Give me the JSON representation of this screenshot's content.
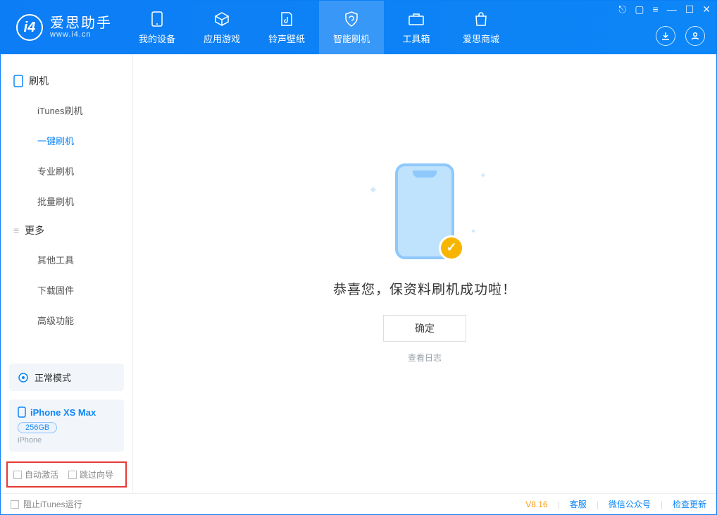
{
  "app": {
    "name": "爱思助手",
    "domain": "www.i4.cn"
  },
  "tabs": [
    {
      "label": "我的设备"
    },
    {
      "label": "应用游戏"
    },
    {
      "label": "铃声壁纸"
    },
    {
      "label": "智能刷机"
    },
    {
      "label": "工具箱"
    },
    {
      "label": "爱思商城"
    }
  ],
  "sidebar": {
    "group1": {
      "title": "刷机"
    },
    "items1": [
      {
        "label": "iTunes刷机"
      },
      {
        "label": "一键刷机"
      },
      {
        "label": "专业刷机"
      },
      {
        "label": "批量刷机"
      }
    ],
    "group2": {
      "title": "更多"
    },
    "items2": [
      {
        "label": "其他工具"
      },
      {
        "label": "下载固件"
      },
      {
        "label": "高级功能"
      }
    ],
    "status": "正常模式",
    "device": {
      "name": "iPhone XS Max",
      "storage": "256GB",
      "type": "iPhone"
    },
    "check1": "自动激活",
    "check2": "跳过向导"
  },
  "main": {
    "message": "恭喜您，保资料刷机成功啦！",
    "ok": "确定",
    "log": "查看日志"
  },
  "footer": {
    "block_itunes": "阻止iTunes运行",
    "version": "V8.16",
    "support": "客服",
    "wechat": "微信公众号",
    "update": "检查更新"
  }
}
